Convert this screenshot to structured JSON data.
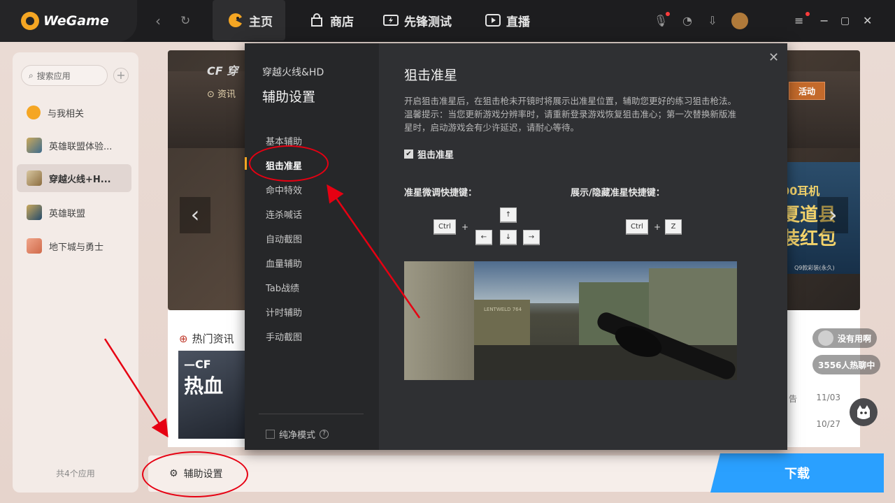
{
  "app": {
    "brand": "WeGame",
    "tabs": [
      {
        "label": "主页",
        "icon": "home-mascot-icon",
        "active": true
      },
      {
        "label": "商店",
        "icon": "shopping-bag-icon",
        "active": false
      },
      {
        "label": "先锋测试",
        "icon": "lightning-ticket-icon",
        "active": false
      },
      {
        "label": "直播",
        "icon": "play-icon",
        "active": false
      }
    ]
  },
  "sidebar": {
    "search_placeholder": "搜索应用",
    "items": [
      {
        "label": "与我相关",
        "icon": "wegame-logo-icon",
        "active": false
      },
      {
        "label": "英雄联盟体验...",
        "icon": "lol-pbe-icon",
        "active": false
      },
      {
        "label": "穿越火线+H...",
        "icon": "crossfire-icon",
        "active": true
      },
      {
        "label": "英雄联盟",
        "icon": "lol-icon",
        "active": false
      },
      {
        "label": "地下城与勇士",
        "icon": "dnf-icon",
        "active": false
      }
    ],
    "footer": "共4个应用"
  },
  "banner": {
    "brand_text": "穿",
    "news_tab": "资讯",
    "activity_tag": "活动",
    "right_headline_1": "00耳机",
    "right_headline_2": "夏道县",
    "right_headline_3": "装红包",
    "right_caption": "Q9款彩装(永久)"
  },
  "news": {
    "title": "热门资讯",
    "thumb_text_1": "—CF",
    "thumb_text_2": "热血",
    "rows": [
      {
        "suffix": "告",
        "date": "11/03"
      },
      {
        "suffix": "",
        "date": "10/27"
      }
    ]
  },
  "bottom": {
    "aux_label": "辅助设置",
    "download_label": "下载"
  },
  "chat": {
    "user_text": "没有用啊",
    "hot_text": "3556人热聊中"
  },
  "modal": {
    "game": "穿越火线&HD",
    "heading": "辅助设置",
    "nav": [
      {
        "label": "基本辅助",
        "active": false
      },
      {
        "label": "狙击准星",
        "active": true
      },
      {
        "label": "命中特效",
        "active": false
      },
      {
        "label": "连杀喊话",
        "active": false
      },
      {
        "label": "自动截图",
        "active": false
      },
      {
        "label": "血量辅助",
        "active": false
      },
      {
        "label": "Tab战绩",
        "active": false
      },
      {
        "label": "计时辅助",
        "active": false
      },
      {
        "label": "手动截图",
        "active": false
      }
    ],
    "pure_mode": "纯净模式",
    "feature_title": "狙击准星",
    "feature_desc": "开启狙击准星后，在狙击枪未开镜时将展示出准星位置，辅助您更好的练习狙击枪法。温馨提示：当您更新游戏分辨率时，请重新登录游戏恢复狙击准心；第一次替换新版准星时，启动游戏会有少许延迟，请耐心等待。",
    "enable_label": "狙击准星",
    "enable_checked": true,
    "hotkey_adjust_label": "准星微调快捷键：",
    "hotkey_toggle_label": "展示/隐藏准星快捷键：",
    "keys": {
      "ctrl": "Ctrl",
      "up": "↑",
      "left": "←",
      "down": "↓",
      "right": "→",
      "z": "Z",
      "plus": "+"
    },
    "preview_crate_label": "LENTWELD 764"
  },
  "colors": {
    "accent_orange": "#f5a623",
    "download_blue": "#2aa0ff",
    "annotation_red": "#e60012"
  }
}
